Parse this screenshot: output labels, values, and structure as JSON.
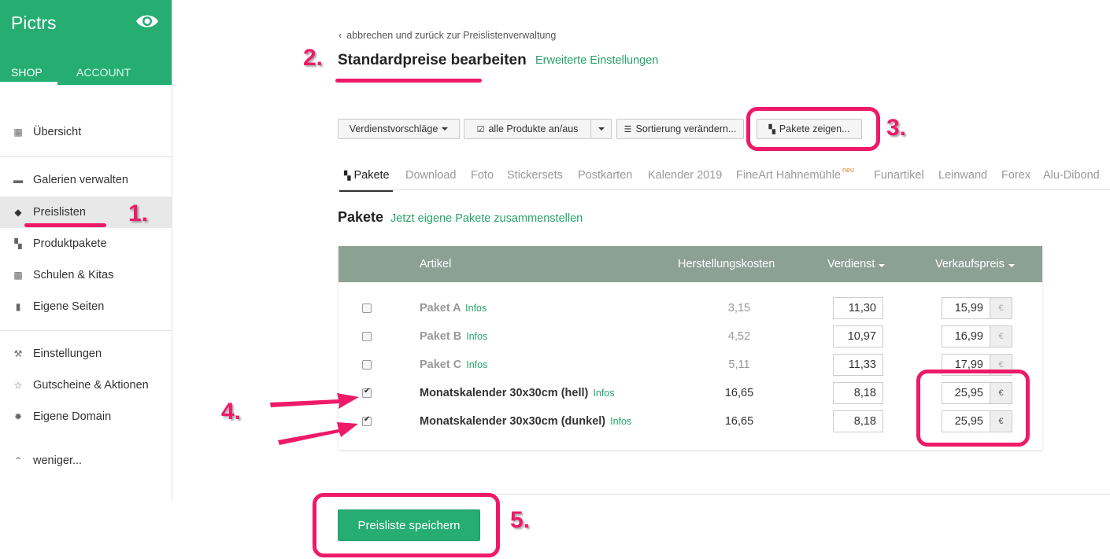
{
  "sidebar": {
    "brand": "Pictrs",
    "tabs": {
      "shop": "SHOP",
      "account": "ACCOUNT"
    },
    "items": [
      {
        "label": "Übersicht",
        "icon": "calendar-icon"
      },
      {
        "label": "Galerien verwalten",
        "icon": "folder-icon"
      },
      {
        "label": "Preislisten",
        "icon": "tags-icon"
      },
      {
        "label": "Produktpakete",
        "icon": "gift-icon"
      },
      {
        "label": "Schulen & Kitas",
        "icon": "qrcode-icon"
      },
      {
        "label": "Eigene Seiten",
        "icon": "file-icon"
      },
      {
        "label": "Einstellungen",
        "icon": "wrench-icon"
      },
      {
        "label": "Gutscheine & Aktionen",
        "icon": "star-icon"
      },
      {
        "label": "Eigene Domain",
        "icon": "certificate-icon"
      },
      {
        "label": "weniger...",
        "icon": "chevron-up-icon"
      }
    ]
  },
  "main": {
    "back_link": "abbrechen und zurück zur Preislistenverwaltung",
    "title": "Standardpreise bearbeiten",
    "advanced_link": "Erweiterte Einstellungen",
    "toolbar": {
      "suggestions": "Verdienstvorschläge",
      "toggle_all": "alle Produkte an/aus",
      "sorting": "Sortierung verändern...",
      "show_packages": "Pakete zeigen..."
    },
    "tabs": [
      "Pakete",
      "Download",
      "Foto",
      "Stickersets",
      "Postkarten",
      "Kalender 2019",
      "FineArt Hahnemühle",
      "Funartikel",
      "Leinwand",
      "Forex",
      "Alu-Dibond"
    ],
    "tab_badge": "neu",
    "section": {
      "title": "Pakete",
      "link": "Jetzt eigene Pakete zusammenstellen"
    },
    "table": {
      "headers": {
        "article": "Artikel",
        "cost": "Herstellungskosten",
        "profit": "Verdienst",
        "price": "Verkaufspreis"
      },
      "infos_label": "Infos",
      "currency": "€",
      "rows": [
        {
          "name": "Paket A",
          "cost": "3,15",
          "profit": "11,30",
          "price": "15,99",
          "checked": false
        },
        {
          "name": "Paket B",
          "cost": "4,52",
          "profit": "10,97",
          "price": "16,99",
          "checked": false
        },
        {
          "name": "Paket C",
          "cost": "5,11",
          "profit": "11,33",
          "price": "17,99",
          "checked": false
        },
        {
          "name": "Monatskalender 30x30cm (hell)",
          "cost": "16,65",
          "profit": "8,18",
          "price": "25,95",
          "checked": true
        },
        {
          "name": "Monatskalender 30x30cm (dunkel)",
          "cost": "16,65",
          "profit": "8,18",
          "price": "25,95",
          "checked": true
        }
      ]
    },
    "save_button": "Preisliste speichern"
  },
  "annotations": {
    "color": "#ee1a68",
    "labels": [
      "1.",
      "2.",
      "3.",
      "4.",
      "5."
    ]
  },
  "colors": {
    "brand": "#25ad72",
    "link": "#25a36b",
    "table_header": "#8ca094"
  }
}
